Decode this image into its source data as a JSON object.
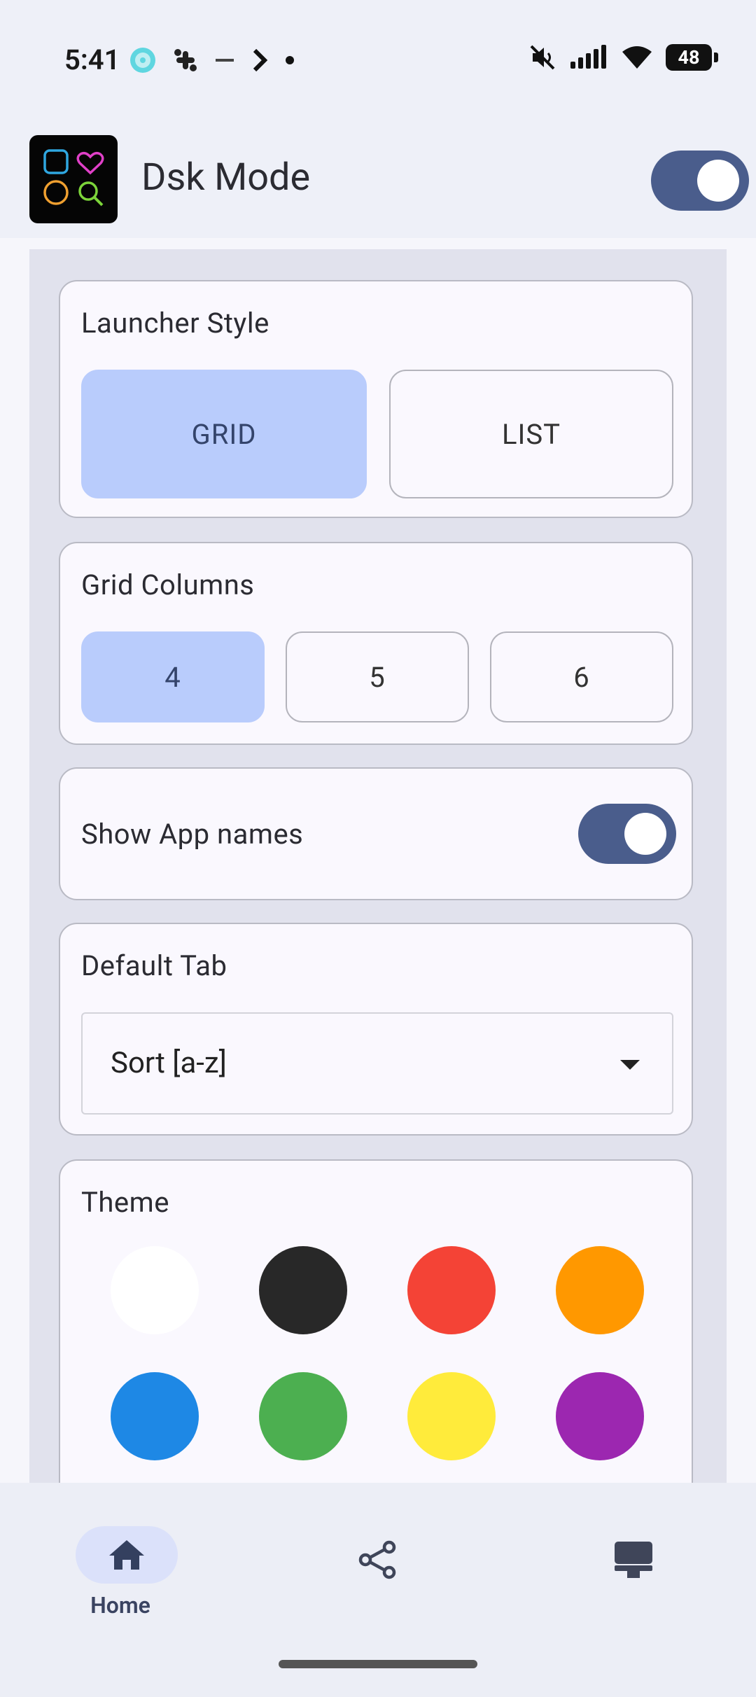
{
  "status_bar": {
    "time": "5:41",
    "battery": "48",
    "icons_left": [
      "media-disc-icon",
      "slack-icon",
      "text-logo-icon",
      "chevron-right-icon",
      "dot-icon"
    ],
    "icons_right": [
      "mute-icon",
      "signal-icon",
      "wifi-icon",
      "battery-icon"
    ]
  },
  "app_bar": {
    "title": "Dsk Mode",
    "toggle_on": true
  },
  "sections": {
    "launcher_style": {
      "title": "Launcher Style",
      "options": [
        "GRID",
        "LIST"
      ],
      "selected": "GRID"
    },
    "grid_columns": {
      "title": "Grid Columns",
      "options": [
        "4",
        "5",
        "6"
      ],
      "selected": "4"
    },
    "show_app_names": {
      "title": "Show App names",
      "on": true
    },
    "default_tab": {
      "title": "Default Tab",
      "value": "Sort [a-z]"
    },
    "theme": {
      "title": "Theme",
      "colors": [
        "#ffffff",
        "#282828",
        "#f44336",
        "#ff9800",
        "#1e88e5",
        "#4caf50",
        "#ffeb3b",
        "#9c27b0"
      ]
    }
  },
  "bottom_nav": {
    "items": [
      {
        "label": "Home",
        "icon": "home-icon",
        "active": true
      },
      {
        "label": "",
        "icon": "share-icon",
        "active": false
      },
      {
        "label": "",
        "icon": "kiosk-icon",
        "active": false
      }
    ]
  },
  "colors": {
    "accent": "#4a5d8c",
    "selected_segment": "#b9ccfc"
  }
}
